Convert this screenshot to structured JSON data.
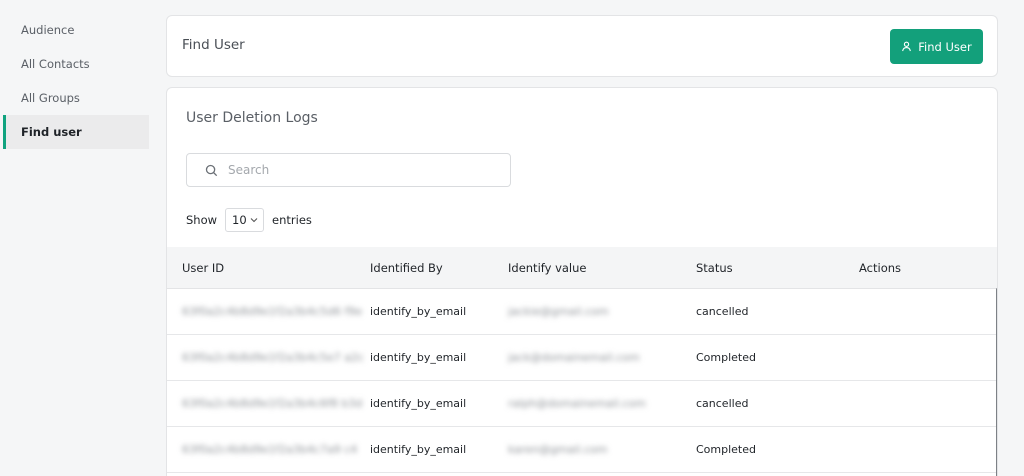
{
  "sidebar": {
    "items": [
      {
        "label": "Audience"
      },
      {
        "label": "All Contacts"
      },
      {
        "label": "All Groups"
      },
      {
        "label": "Find user"
      }
    ]
  },
  "header": {
    "title": "Find User",
    "button_label": "Find User",
    "button_icon": "user-icon",
    "accent": "#13a07b"
  },
  "logs": {
    "title": "User Deletion Logs",
    "search_placeholder": "Search",
    "show_label": "Show",
    "entries_value": "10",
    "entries_label": "entries"
  },
  "table": {
    "columns": [
      "User ID",
      "Identified By",
      "Identify value",
      "Status",
      "Actions"
    ],
    "rows": [
      {
        "user_id": "63f0a2c4b8d9e1f2a3b4c5d6  f9e",
        "identified_by": "identify_by_email",
        "identify_value": "jackie@gmail.com",
        "status": "cancelled"
      },
      {
        "user_id": "63f0a2c4b8d9e1f2a3b4c5e7  a2c",
        "identified_by": "identify_by_email",
        "identify_value": "jack@domainemail.com",
        "status": "Completed"
      },
      {
        "user_id": "63f0a2c4b8d9e1f2a3b4c6f8  b3d",
        "identified_by": "identify_by_email",
        "identify_value": "ralph@domainemail.com",
        "status": "cancelled"
      },
      {
        "user_id": "63f0a2c4b8d9e1f2a3b4c7a9  c4",
        "identified_by": "identify_by_email",
        "identify_value": "karen@gmail.com",
        "status": "Completed"
      }
    ]
  }
}
